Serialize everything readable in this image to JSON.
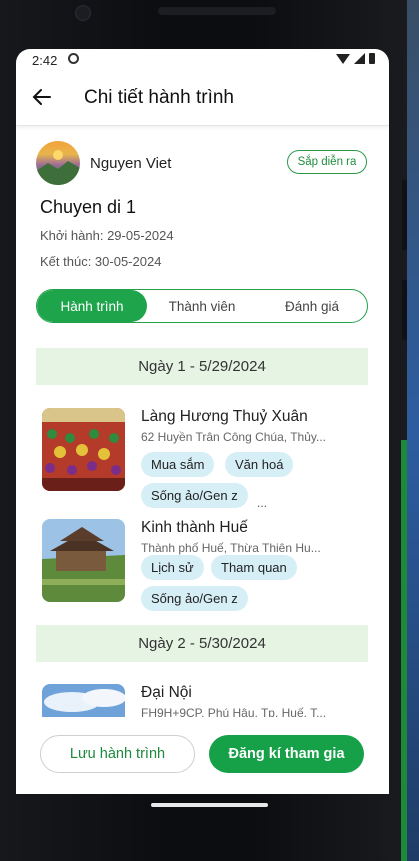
{
  "status_bar": {
    "time": "2:42"
  },
  "header": {
    "title": "Chi tiết hành trình"
  },
  "trip": {
    "owner_name": "Nguyen Viet",
    "status": "Sắp diễn ra",
    "name": "Chuyen di 1",
    "start": "Khởi hành: 29-05-2024",
    "end": "Kết thúc: 30-05-2024"
  },
  "tabs": [
    {
      "label": "Hành trình",
      "active": true
    },
    {
      "label": "Thành viên",
      "active": false
    },
    {
      "label": "Đánh giá",
      "active": false
    }
  ],
  "days": [
    {
      "title": "Ngày 1 - 5/29/2024",
      "places": [
        {
          "name": "Làng Hương Thuỷ Xuân",
          "address": "62 Huyền Trân Công Chúa, Thủy...",
          "tags": [
            "Mua sắm",
            "Văn hoá",
            "Sống ảo/Gen z"
          ],
          "more": "..."
        },
        {
          "name": "Kinh thành Huế",
          "address": "Thành phố Huế, Thừa Thiên Hu...",
          "tags": [
            "Lịch sử",
            "Tham quan",
            "Sống ảo/Gen z"
          ]
        }
      ]
    },
    {
      "title": "Ngày 2 - 5/30/2024",
      "places": [
        {
          "name": "Đại Nội",
          "address": "FH9H+9CP, Phú Hậu, Tp. Huế, T..."
        }
      ]
    }
  ],
  "actions": {
    "save_label": "Lưu hành trình",
    "join_label": "Đăng kí tham gia"
  },
  "colors": {
    "accent": "#16a047",
    "day_header_bg": "#e5f4e3",
    "chip_bg": "#d6eef5"
  }
}
